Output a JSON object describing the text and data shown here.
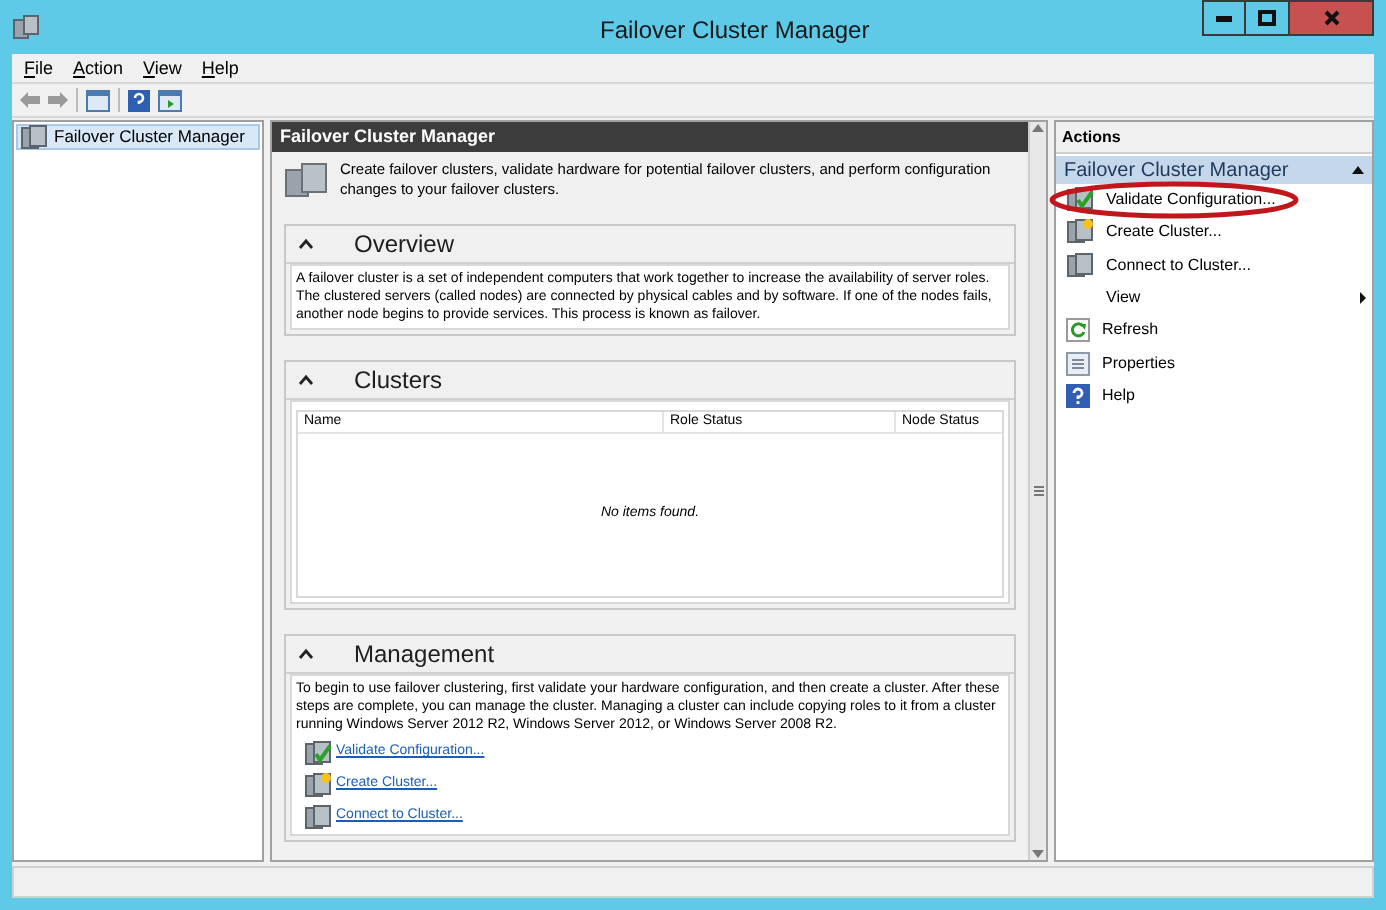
{
  "window": {
    "title": "Failover Cluster Manager"
  },
  "menu": [
    {
      "label": "File"
    },
    {
      "label": "Action"
    },
    {
      "label": "View"
    },
    {
      "label": "Help"
    }
  ],
  "tree": [
    {
      "label": "Failover Cluster Manager",
      "selected": true
    }
  ],
  "center": {
    "title": "Failover Cluster Manager",
    "intro": "Create failover clusters, validate hardware for potential failover clusters, and perform configuration changes to your failover clusters.",
    "overview": {
      "title": "Overview",
      "expanded": true,
      "text": "A failover cluster is a set of independent computers that work together to increase the availability of server roles. The clustered servers (called nodes) are connected by physical cables and by software. If one of the nodes fails, another node begins to provide services. This process is known as failover."
    },
    "clusters": {
      "title": "Clusters",
      "expanded": true,
      "columns": [
        "Name",
        "Role Status",
        "Node Status"
      ],
      "empty": "No items found."
    },
    "management": {
      "title": "Management",
      "expanded": true,
      "text": "To begin to use failover clustering, first validate your hardware configuration, and then create a cluster.  After these steps are complete, you can manage the cluster. Managing a cluster can include copying roles to it from a cluster running Windows Server 2012 R2, Windows Server 2012, or Windows Server 2008 R2.",
      "links": [
        {
          "label": "Validate Configuration...",
          "kind": "validate"
        },
        {
          "label": "Create Cluster...",
          "kind": "create"
        },
        {
          "label": "Connect to Cluster...",
          "kind": "connect"
        }
      ]
    }
  },
  "actions": {
    "title": "Actions",
    "group": "Failover Cluster Manager",
    "items": [
      {
        "label": "Validate Configuration...",
        "kind": "validate",
        "circled": true
      },
      {
        "label": "Create Cluster...",
        "kind": "create",
        "circled": false
      },
      {
        "label": "Connect to Cluster...",
        "kind": "connect",
        "circled": false
      },
      {
        "label": "View",
        "kind": "submenu",
        "circled": false
      },
      {
        "label": "Refresh",
        "kind": "refresh",
        "circled": false
      },
      {
        "label": "Properties",
        "kind": "properties",
        "circled": false
      },
      {
        "label": "Help",
        "kind": "help",
        "circled": false
      }
    ]
  }
}
